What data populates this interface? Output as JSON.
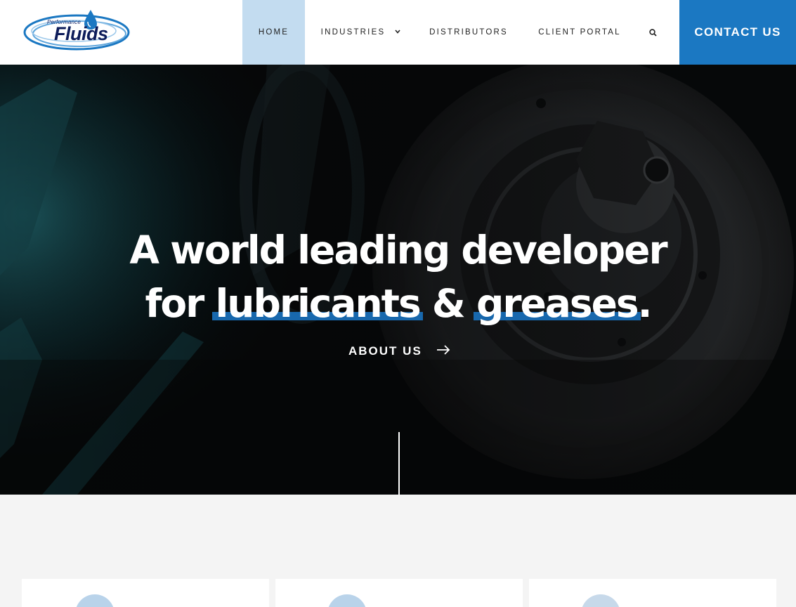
{
  "brand": {
    "logo_small_text": "Performance",
    "logo_main_text": "Fluids",
    "primary_color": "#1b78c2",
    "active_nav_color": "#c3dcf0",
    "highlight_color": "#1868ad"
  },
  "nav": {
    "home": "HOME",
    "industries": "INDUSTRIES",
    "industries_chevron": "chevron-down-icon",
    "distributors": "DISTRIBUTORS",
    "client_portal": "CLIENT PORTAL",
    "search_icon": "search-icon",
    "contact": "CONTACT US",
    "active_item": "HOME"
  },
  "hero": {
    "line1": "A world leading developer",
    "line2_prefix": "for ",
    "highlight_1": "lubricants",
    "connector": " & ",
    "highlight_2": "greases",
    "suffix": ".",
    "cta_label": "ABOUT US",
    "cta_icon": "arrow-right-icon"
  }
}
